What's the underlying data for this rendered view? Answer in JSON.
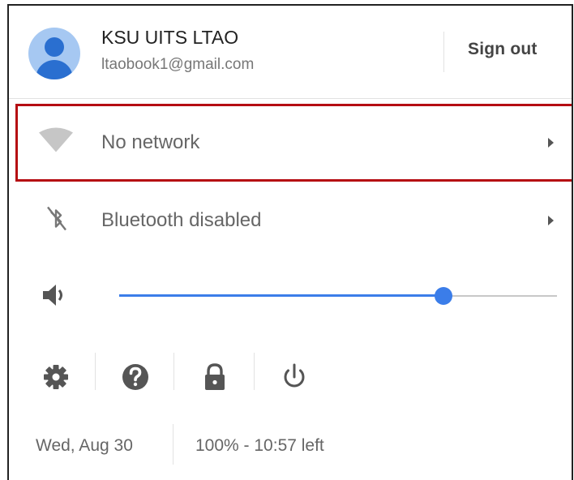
{
  "user": {
    "name": "KSU UITS LTAO",
    "email": "ltaobook1@gmail.com",
    "sign_out_label": "Sign out"
  },
  "network": {
    "label": "No network",
    "icon": "wifi-off-icon"
  },
  "bluetooth": {
    "label": "Bluetooth disabled",
    "icon": "bluetooth-disabled-icon"
  },
  "volume": {
    "icon": "volume-icon",
    "level": 0.74
  },
  "actions": [
    {
      "name": "settings",
      "icon": "gear-icon"
    },
    {
      "name": "help",
      "icon": "help-icon"
    },
    {
      "name": "lock",
      "icon": "lock-icon"
    },
    {
      "name": "power",
      "icon": "power-icon"
    }
  ],
  "status": {
    "date": "Wed, Aug 30",
    "battery": "100% - 10:57 left"
  },
  "colors": {
    "accent": "#3b7de9",
    "highlight": "#b50d12"
  }
}
